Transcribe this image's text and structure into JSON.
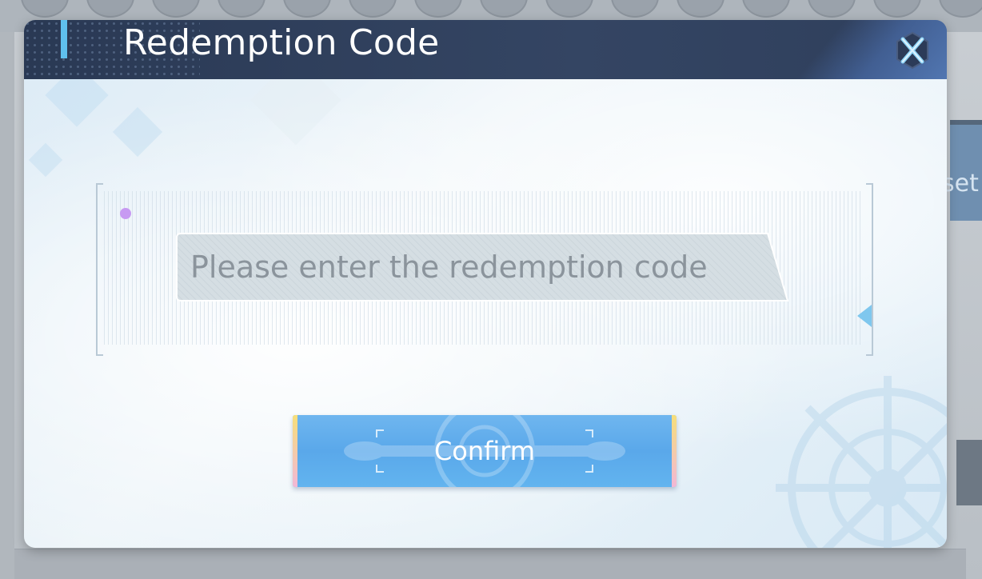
{
  "background": {
    "partial_button_label": "set"
  },
  "dialog": {
    "title": "Redemption Code",
    "close_icon": "close-x-icon",
    "input": {
      "value": "",
      "placeholder": "Please enter the redemption code"
    },
    "confirm_label": "Confirm"
  },
  "colors": {
    "title_bar": "#2f3f5c",
    "accent": "#5fc0ee",
    "confirm_button": "#5aa8ea",
    "dot": "#c79af2"
  }
}
